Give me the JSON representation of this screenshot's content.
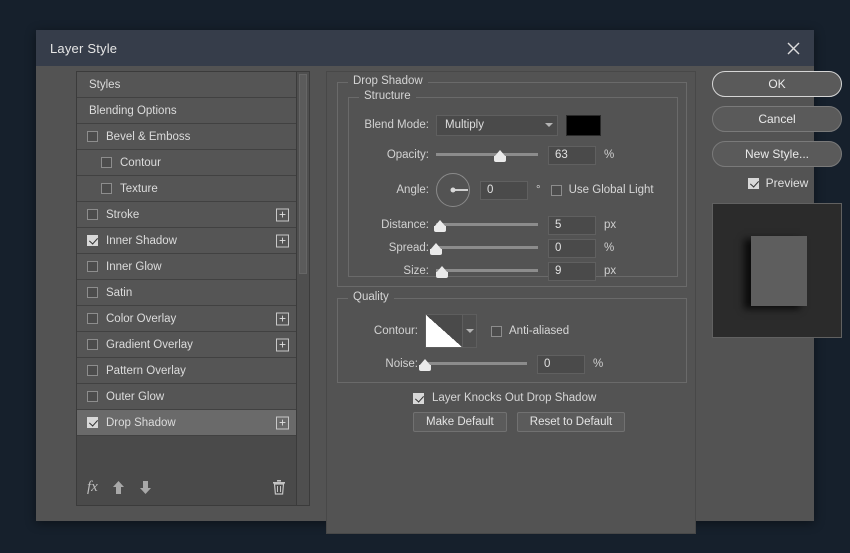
{
  "window": {
    "title": "Layer Style",
    "close_icon": "close-icon"
  },
  "styles_panel": {
    "items": [
      {
        "label": "Styles",
        "type": "plain",
        "checked": false,
        "has_plus": false,
        "selected": false,
        "indent": false
      },
      {
        "label": "Blending Options",
        "type": "plain",
        "checked": false,
        "has_plus": false,
        "selected": false,
        "indent": false
      },
      {
        "label": "Bevel & Emboss",
        "type": "checkbox",
        "checked": false,
        "has_plus": false,
        "selected": false,
        "indent": false
      },
      {
        "label": "Contour",
        "type": "checkbox",
        "checked": false,
        "has_plus": false,
        "selected": false,
        "indent": true
      },
      {
        "label": "Texture",
        "type": "checkbox",
        "checked": false,
        "has_plus": false,
        "selected": false,
        "indent": true
      },
      {
        "label": "Stroke",
        "type": "checkbox",
        "checked": false,
        "has_plus": true,
        "selected": false,
        "indent": false
      },
      {
        "label": "Inner Shadow",
        "type": "checkbox",
        "checked": true,
        "has_plus": true,
        "selected": false,
        "indent": false
      },
      {
        "label": "Inner Glow",
        "type": "checkbox",
        "checked": false,
        "has_plus": false,
        "selected": false,
        "indent": false
      },
      {
        "label": "Satin",
        "type": "checkbox",
        "checked": false,
        "has_plus": false,
        "selected": false,
        "indent": false
      },
      {
        "label": "Color Overlay",
        "type": "checkbox",
        "checked": false,
        "has_plus": true,
        "selected": false,
        "indent": false
      },
      {
        "label": "Gradient Overlay",
        "type": "checkbox",
        "checked": false,
        "has_plus": true,
        "selected": false,
        "indent": false
      },
      {
        "label": "Pattern Overlay",
        "type": "checkbox",
        "checked": false,
        "has_plus": false,
        "selected": false,
        "indent": false
      },
      {
        "label": "Outer Glow",
        "type": "checkbox",
        "checked": false,
        "has_plus": false,
        "selected": false,
        "indent": false
      },
      {
        "label": "Drop Shadow",
        "type": "checkbox",
        "checked": true,
        "has_plus": true,
        "selected": true,
        "indent": false
      }
    ],
    "footer": {
      "fx_label": "fx",
      "fx_icon": "fx-icon",
      "move_up_icon": "arrow-up-icon",
      "move_down_icon": "arrow-down-icon",
      "delete_icon": "trash-icon"
    }
  },
  "effect": {
    "group_title": "Drop Shadow",
    "structure": {
      "legend": "Structure",
      "blend_mode_label": "Blend Mode:",
      "blend_mode_value": "Multiply",
      "color_swatch": "#000000",
      "opacity_label": "Opacity:",
      "opacity_value": "63",
      "opacity_unit": "%",
      "opacity_pct": 63,
      "angle_label": "Angle:",
      "angle_value": "0",
      "angle_unit": "°",
      "use_global_light_label": "Use Global Light",
      "use_global_light_checked": false,
      "distance_label": "Distance:",
      "distance_value": "5",
      "distance_unit": "px",
      "distance_pct": 4,
      "spread_label": "Spread:",
      "spread_value": "0",
      "spread_unit": "%",
      "spread_pct": 0,
      "size_label": "Size:",
      "size_value": "9",
      "size_unit": "px",
      "size_pct": 6
    },
    "quality": {
      "legend": "Quality",
      "contour_label": "Contour:",
      "anti_aliased_label": "Anti-aliased",
      "anti_aliased_checked": false,
      "noise_label": "Noise:",
      "noise_value": "0",
      "noise_unit": "%",
      "noise_pct": 0
    },
    "knockout_label": "Layer Knocks Out Drop Shadow",
    "knockout_checked": true,
    "make_default_label": "Make Default",
    "reset_default_label": "Reset to Default"
  },
  "actions": {
    "ok_label": "OK",
    "cancel_label": "Cancel",
    "new_style_label": "New Style...",
    "preview_label": "Preview",
    "preview_checked": true
  },
  "colors": {
    "dialog_bg": "#535353",
    "titlebar_bg": "#363d4a",
    "page_bg": "#16202c",
    "row_bg": "#555555",
    "row_selected_bg": "#6a6a6a",
    "text": "#dcdcdc"
  }
}
